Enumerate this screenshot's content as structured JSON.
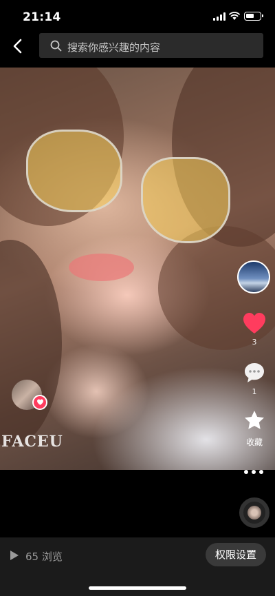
{
  "status_bar": {
    "time": "21:14"
  },
  "nav": {
    "search_placeholder": "搜索你感兴趣的内容"
  },
  "photo": {
    "watermark": "FACEU"
  },
  "actions": {
    "like_count": "3",
    "comment_count": "1",
    "favorite_label": "收藏"
  },
  "footer": {
    "views": "65 浏览",
    "permission_label": "权限设置"
  },
  "colors": {
    "like_red": "#ff3c5e",
    "background": "#000000",
    "bottom_bar": "#1b1b1b"
  },
  "icons": {
    "back": "chevron-left-icon",
    "search": "search-icon",
    "like": "heart-icon",
    "comment": "comment-bubble-icon",
    "favorite": "star-icon",
    "more": "more-dots-icon",
    "play": "play-icon"
  }
}
